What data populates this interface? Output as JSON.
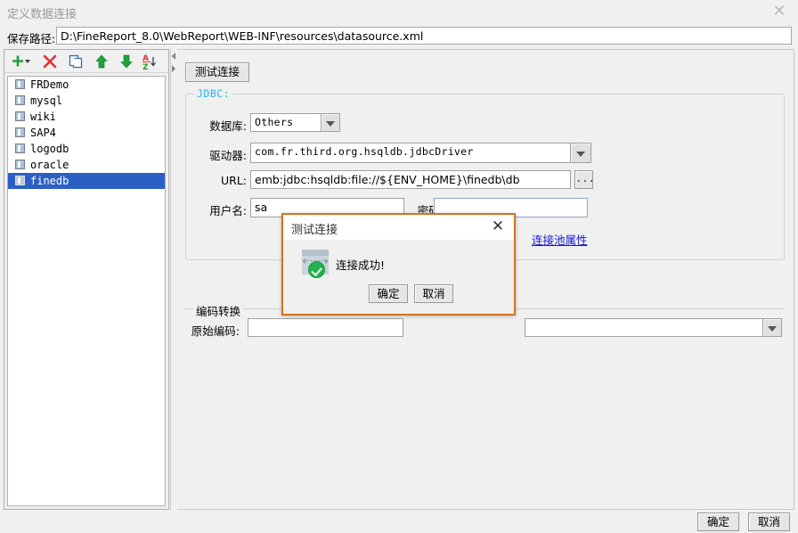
{
  "window": {
    "title": "定义数据连接",
    "close_icon": "close-icon"
  },
  "path_row": {
    "label": "保存路径:",
    "value": "D:\\FineReport_8.0\\WebReport\\WEB-INF\\resources\\datasource.xml"
  },
  "toolbar": {
    "items": [
      {
        "name": "add-icon",
        "glyph": "+"
      },
      {
        "name": "delete-icon",
        "glyph": "✕"
      },
      {
        "name": "copy-icon",
        "glyph": "copy"
      },
      {
        "name": "move-up-icon",
        "glyph": "↑"
      },
      {
        "name": "move-down-icon",
        "glyph": "↓"
      },
      {
        "name": "sort-az-icon",
        "glyph": "AZ"
      }
    ]
  },
  "connection_list": {
    "items": [
      {
        "label": "FRDemo",
        "selected": false
      },
      {
        "label": "mysql",
        "selected": false
      },
      {
        "label": "wiki",
        "selected": false
      },
      {
        "label": "SAP4",
        "selected": false
      },
      {
        "label": "logodb",
        "selected": false
      },
      {
        "label": "oracle",
        "selected": false
      },
      {
        "label": "finedb",
        "selected": true
      }
    ]
  },
  "main": {
    "test_button": "测试连接",
    "jdbc_group_label": "JDBC:",
    "fields": {
      "database_label": "数据库:",
      "database_value": "Others",
      "driver_label": "驱动器:",
      "driver_value": "com.fr.third.org.hsqldb.jdbcDriver",
      "url_label": "URL:",
      "url_value": "emb:jdbc:hsqldb:file://${ENV_HOME}\\finedb\\db",
      "url_browse_label": "...",
      "username_label": "用户名:",
      "username_value": "sa",
      "password_label": "密码:",
      "password_value": ""
    },
    "pool_link": "连接池属性",
    "encoding_group_label": "编码转换",
    "encoding_field_label": "原始编码:",
    "encoding_value": "",
    "encoding_right_value": ""
  },
  "footer": {
    "ok": "确定",
    "cancel": "取消"
  },
  "dialog": {
    "title": "测试连接",
    "close_icon": "close-icon",
    "message": "连接成功!",
    "ok": "确定",
    "cancel": "取消",
    "border_color": "#d4731f",
    "success_color": "#22b14c"
  },
  "colors": {
    "selection": "#2b5fc4",
    "group_label": "#29b6e8",
    "link": "#1616d8",
    "window_bg": "#f0f0f0"
  }
}
